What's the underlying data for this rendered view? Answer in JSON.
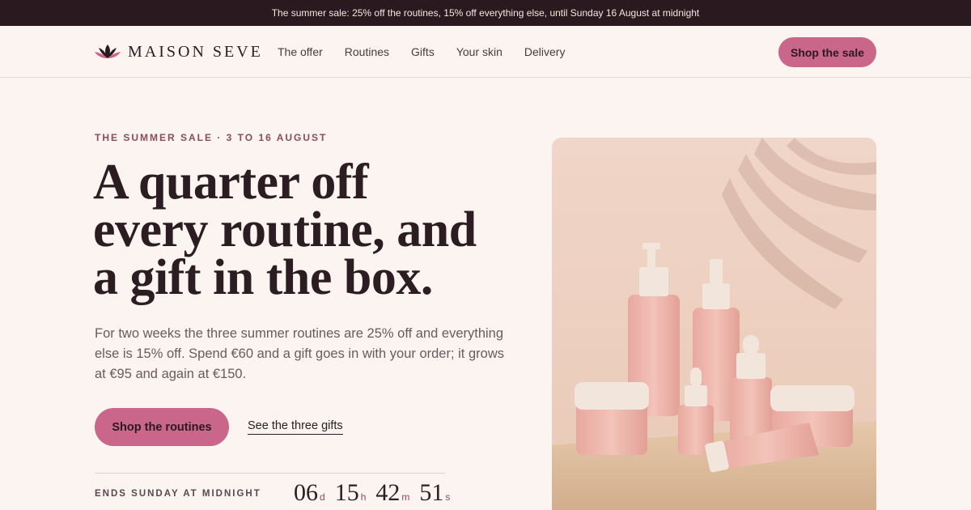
{
  "announcement": {
    "text": "The summer sale: 25% off the routines, 15% off everything else, until Sunday 16 August at midnight"
  },
  "brand": {
    "name": "MAISON SEVE",
    "logo_icon": "lotus-icon"
  },
  "nav": {
    "links": [
      "The offer",
      "Routines",
      "Gifts",
      "Your skin",
      "Delivery"
    ],
    "cta_label": "Shop the sale"
  },
  "hero": {
    "eyebrow": "THE SUMMER SALE · 3 TO 16 AUGUST",
    "headline_lines": [
      "A quarter off",
      "every routine, and",
      "a gift in the box."
    ],
    "body": "For two weeks the three summer routines are 25% off and everything else is 15% off. Spend €60 and a gift goes in with your order; it grows at €95 and again at €150.",
    "primary_cta": "Shop the routines",
    "secondary_cta": "See the three gifts"
  },
  "countdown": {
    "label": "ENDS SUNDAY AT MIDNIGHT",
    "days": "06",
    "days_unit": "d",
    "hours": "15",
    "hours_unit": "h",
    "minutes": "42",
    "minutes_unit": "m",
    "seconds": "51",
    "seconds_unit": "s"
  },
  "colors": {
    "accent": "#c9668a",
    "bar": "#2a1a1f",
    "background": "#fbf4f0"
  }
}
